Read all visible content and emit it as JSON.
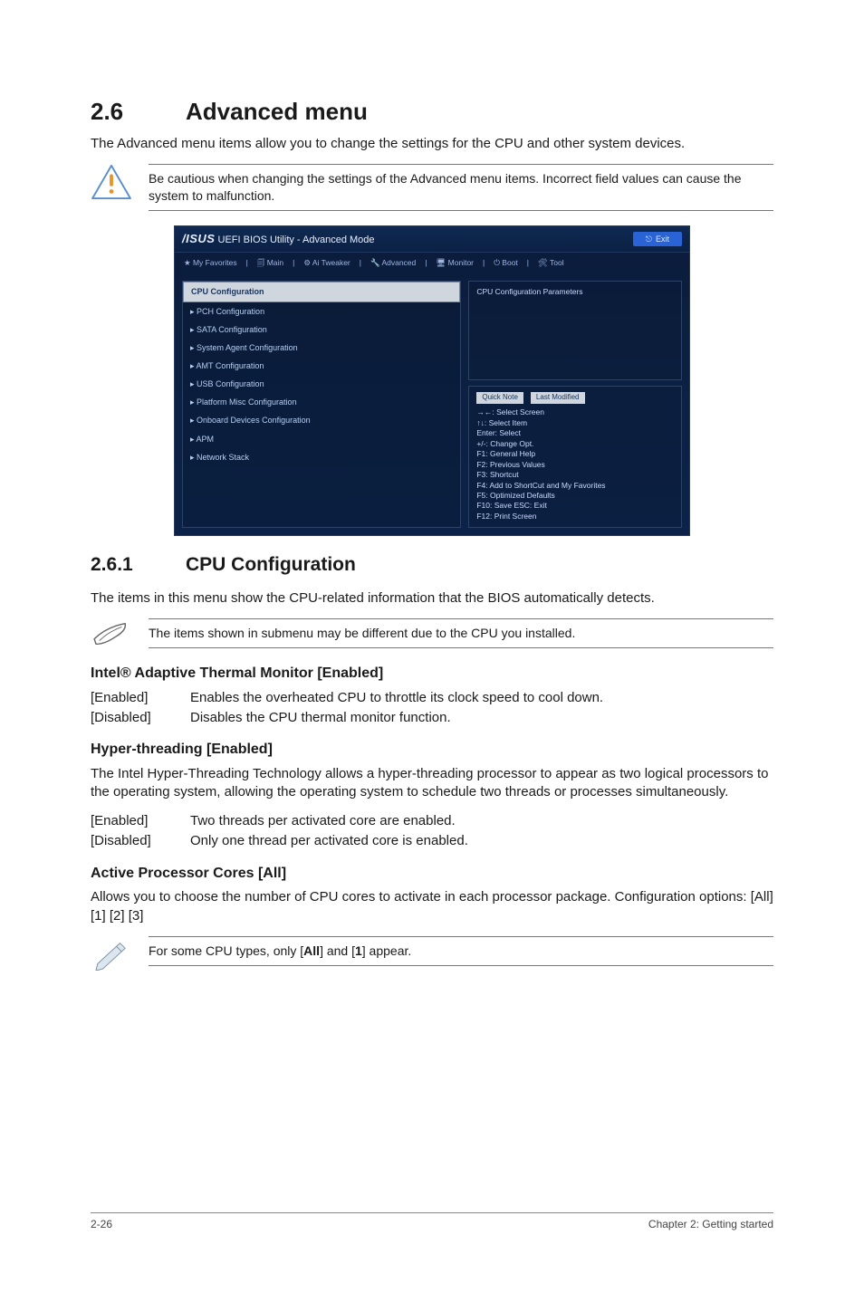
{
  "section": {
    "num": "2.6",
    "title": "Advanced menu"
  },
  "intro": "The Advanced menu items allow you to change the settings for the CPU and other system devices.",
  "caution": "Be cautious when changing the settings of the Advanced menu items. Incorrect field values can cause the system to malfunction.",
  "bios": {
    "brand": "/ISUS",
    "title": "UEFI BIOS Utility - Advanced Mode",
    "exit": "Exit",
    "tabs": [
      "★ My Favorites",
      "🗐 Main",
      "⚙ Ai Tweaker",
      "🔧 Advanced",
      "🖥 Monitor",
      "⏻ Boot",
      "🛠 Tool"
    ],
    "left": [
      "CPU Configuration",
      "PCH Configuration",
      "SATA Configuration",
      "System Agent Configuration",
      "AMT Configuration",
      "USB Configuration",
      "Platform Misc Configuration",
      "Onboard Devices Configuration",
      "APM",
      "Network Stack"
    ],
    "rightTop": "CPU Configuration Parameters",
    "paneTabs": [
      "Quick Note",
      "Last Modified"
    ],
    "help": [
      "→←: Select Screen",
      "↑↓: Select Item",
      "Enter: Select",
      "+/-: Change Opt.",
      "F1: General Help",
      "F2: Previous Values",
      "F3: Shortcut",
      "F4: Add to ShortCut and My Favorites",
      "F5: Optimized Defaults",
      "F10: Save  ESC: Exit",
      "F12: Print Screen"
    ]
  },
  "sub": {
    "num": "2.6.1",
    "title": "CPU Configuration"
  },
  "subIntro": "The items in this menu show the CPU-related information that the BIOS automatically detects.",
  "note1": "The items shown in submenu may be different due to the CPU you installed.",
  "opt1": {
    "title": "Intel® Adaptive Thermal Monitor [Enabled]",
    "rows": [
      {
        "k": "[Enabled]",
        "v": "Enables the overheated CPU to throttle its clock speed to cool down."
      },
      {
        "k": "[Disabled]",
        "v": "Disables the CPU thermal monitor function."
      }
    ]
  },
  "opt2": {
    "title": "Hyper-threading [Enabled]",
    "desc": "The Intel Hyper-Threading Technology allows a hyper-threading processor to appear as two logical processors to the operating system, allowing the operating system to schedule two threads or processes simultaneously.",
    "rows": [
      {
        "k": "[Enabled]",
        "v": "Two threads per activated core are enabled."
      },
      {
        "k": "[Disabled]",
        "v": "Only one thread per activated core is enabled."
      }
    ]
  },
  "opt3": {
    "title": "Active Processor Cores [All]",
    "desc": "Allows you to choose the number of CPU cores to activate in each processor package. Configuration options: [All] [1] [2] [3]"
  },
  "note2_pre": "For some CPU types, only [",
  "note2_b1": "All",
  "note2_mid": "] and [",
  "note2_b2": "1",
  "note2_post": "] appear.",
  "footer": {
    "page": "2-26",
    "chapter": "Chapter 2: Getting started"
  }
}
